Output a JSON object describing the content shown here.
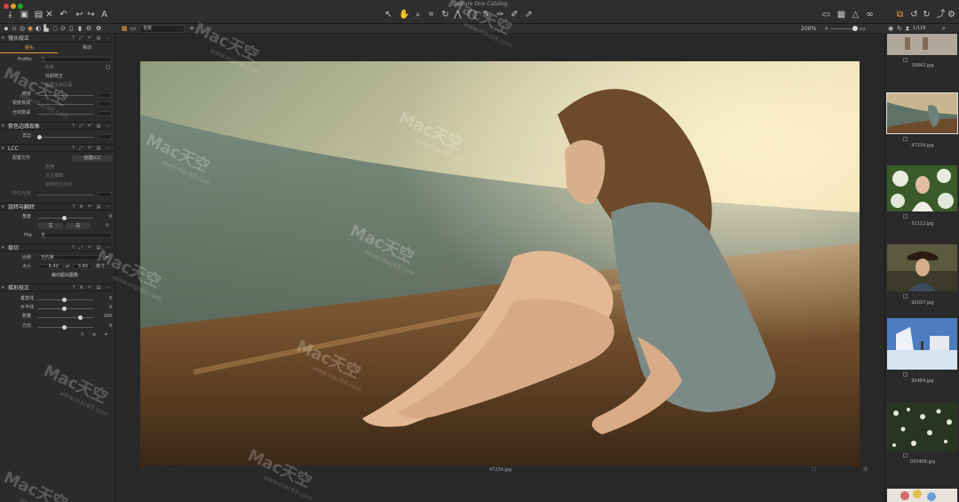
{
  "window": {
    "title": "Capture One Catalog"
  },
  "toolbar": {
    "view_select": "背景",
    "zoom_level": "200%",
    "image_counter": "1/118"
  },
  "tools": {
    "lens": {
      "title": "镜头校正",
      "tab_lens": "镜头",
      "tab_move": "移动",
      "profile_label": "Profile",
      "profile_value": "无",
      "chromatic": "色差",
      "purple_fix": "日耐校正",
      "hide_area": "隐藏主曲区域",
      "distortion": "畸变",
      "sharpness": "锐度衰减",
      "light_falloff": "光线衰减"
    },
    "fringe": {
      "title": "紫色边缘现象",
      "amount_label": "去边"
    },
    "lcc": {
      "title": "LCC",
      "profile_label": "配置文件",
      "create_button": "创建LCC",
      "color": "色描",
      "dust": "灰尘屡精",
      "uniform": "启用均匀光线",
      "uniform_light": "均匀光线"
    },
    "rotation": {
      "title": "旋转与翻转",
      "angle_label": "角度",
      "angle_value": "0",
      "left_button": "左",
      "right_button": "右",
      "flip_label": "Flip",
      "flip_value": "无"
    },
    "crop": {
      "title": "裁切",
      "ratio_label": "比例",
      "ratio_value": "无约束",
      "size_label": "大小",
      "width": "6.40",
      "height": "3.60",
      "unit": "英寸",
      "crop_outside": "裁切超出图像"
    },
    "keystone": {
      "title": "梯形校正",
      "vertical_label": "垂直线",
      "vertical_value": "0",
      "horizontal_label": "水平线",
      "horizontal_value": "0",
      "amount_label": "数量",
      "amount_value": "100",
      "aspect_label": "方向",
      "aspect_value": "0"
    }
  },
  "viewer": {
    "filename": "47234.jpg"
  },
  "browser": {
    "thumbnails": [
      {
        "name": "39842.jpg"
      },
      {
        "name": "47234.jpg"
      },
      {
        "name": "52112.jpg"
      },
      {
        "name": "92037.jpg"
      },
      {
        "name": "92484.jpg"
      },
      {
        "name": "093458.jpg"
      }
    ]
  },
  "watermark": {
    "brand": "Mac天空",
    "url": "www.mac69.com"
  }
}
